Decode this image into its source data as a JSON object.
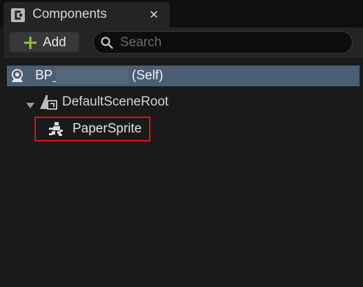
{
  "tab": {
    "title": "Components",
    "close_glyph": "✕",
    "icon": "components-icon"
  },
  "toolbar": {
    "add_label": "Add",
    "add_icon": "plus-icon",
    "search_placeholder": "Search",
    "search_value": "",
    "search_icon": "search-icon"
  },
  "tree": {
    "self_row": {
      "prefix": "BP_",
      "suffix": "(Self)",
      "icon": "actor-icon",
      "selected": true
    },
    "root_row": {
      "label": "DefaultSceneRoot",
      "icon": "scene-root-icon",
      "expanded": true
    },
    "sprite_row": {
      "label": "PaperSprite",
      "icon": "paper-sprite-icon",
      "highlighted": true
    }
  },
  "colors": {
    "accent_plus": "#8ec63f",
    "selection": "#4b5e74",
    "highlight_border": "#e0141a"
  }
}
